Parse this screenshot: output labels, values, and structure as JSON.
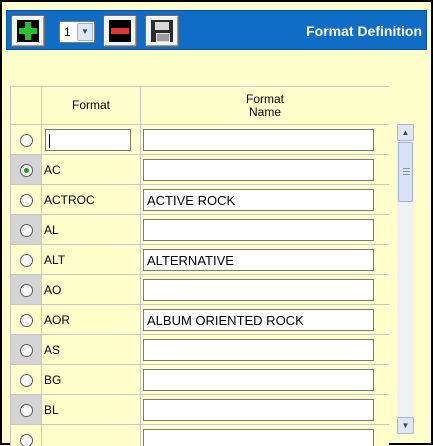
{
  "toolbar": {
    "title": "Format Definition",
    "page_value": "1",
    "add_icon": "plus-icon",
    "delete_icon": "minus-icon",
    "save_icon": "save-disk-icon",
    "bar_color": "#0f6cc7"
  },
  "grid": {
    "columns": [
      "Format",
      "Format Name"
    ],
    "column_format_name_line1": "Format",
    "column_format_name_line2": "Name",
    "rows": [
      {
        "code": "",
        "name": "",
        "selected": false,
        "editable_code": true
      },
      {
        "code": "AC",
        "name": "",
        "selected": true
      },
      {
        "code": "ACTROC",
        "name": "ACTIVE ROCK",
        "selected": false
      },
      {
        "code": "AL",
        "name": "",
        "selected": false
      },
      {
        "code": "ALT",
        "name": "ALTERNATIVE",
        "selected": false
      },
      {
        "code": "AO",
        "name": "",
        "selected": false
      },
      {
        "code": "AOR",
        "name": "ALBUM ORIENTED ROCK",
        "selected": false
      },
      {
        "code": "AS",
        "name": "",
        "selected": false
      },
      {
        "code": "BG",
        "name": "",
        "selected": false
      },
      {
        "code": "BL",
        "name": "",
        "selected": false
      },
      {
        "code": "",
        "name": "",
        "selected": false
      }
    ]
  },
  "colors": {
    "background": "#ffffcc",
    "selector_shaded": "#d4d4d4"
  }
}
